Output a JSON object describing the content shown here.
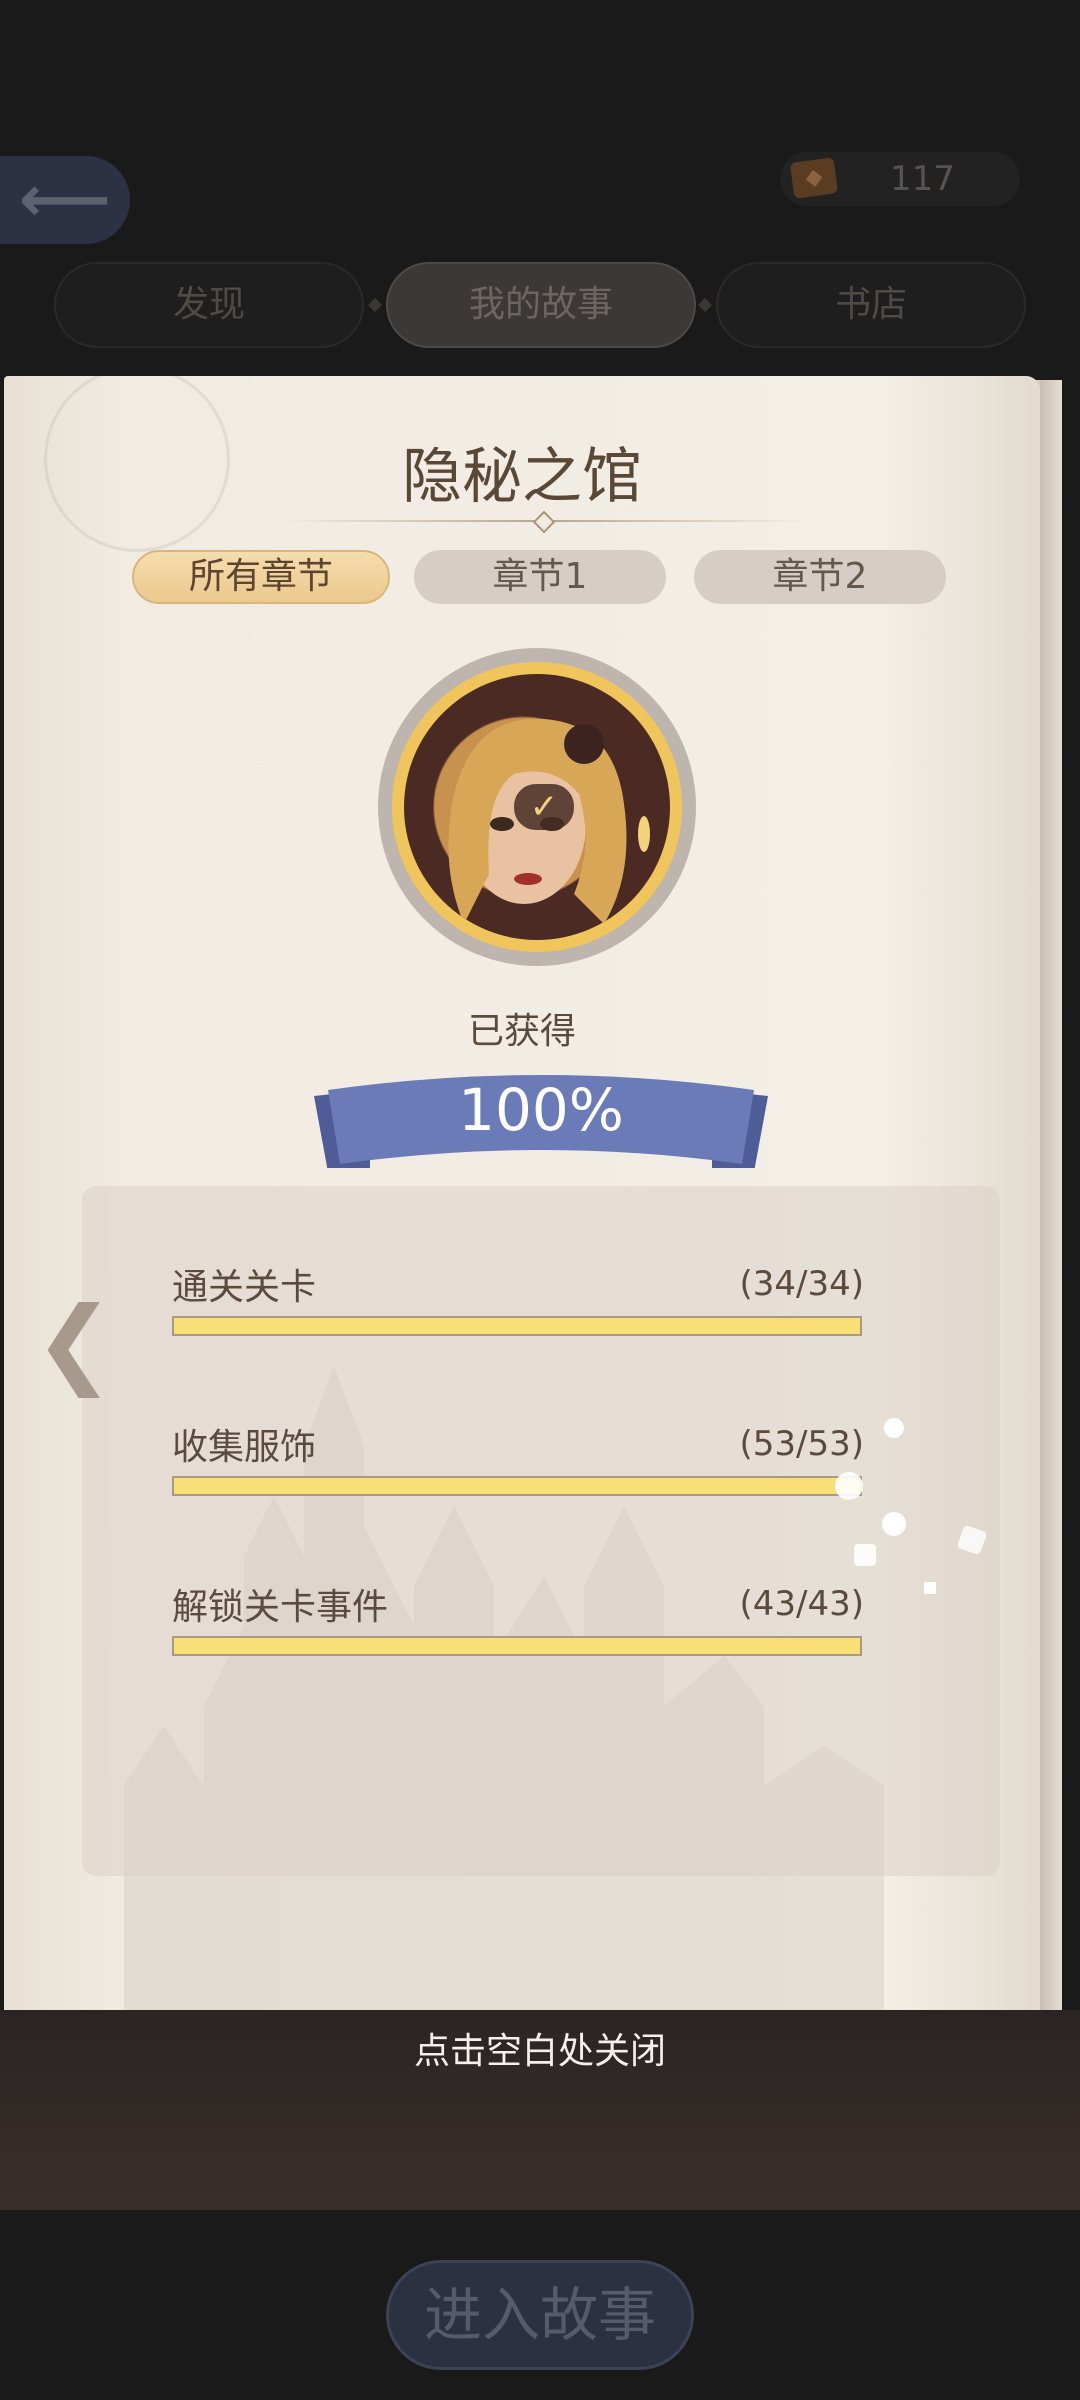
{
  "header": {
    "back_icon": "back-arrow-icon",
    "currency_icon": "ticket-icon",
    "currency_value": "117"
  },
  "tabs": [
    {
      "label": "发现",
      "active": false
    },
    {
      "label": "我的故事",
      "active": true
    },
    {
      "label": "书店",
      "active": false
    }
  ],
  "book": {
    "title": "隐秘之馆",
    "chapter_tabs": [
      {
        "label": "所有章节",
        "active": true
      },
      {
        "label": "章节1",
        "active": false
      },
      {
        "label": "章节2",
        "active": false
      }
    ],
    "avatar_status_icon": "check-icon",
    "obtained_label": "已获得",
    "progress_percent": "100%",
    "stats": [
      {
        "label": "通关关卡",
        "count": "(34/34)",
        "fraction": 1.0
      },
      {
        "label": "收集服饰",
        "count": "(53/53)",
        "fraction": 1.0
      },
      {
        "label": "解锁关卡事件",
        "count": "(43/43)",
        "fraction": 1.0
      }
    ],
    "prev_icon": "chevron-left-icon"
  },
  "footer": {
    "close_hint": "点击空白处关闭",
    "enter_button": "进入故事"
  },
  "colors": {
    "page": "#f1ebe2",
    "accent_gold": "#f0c65c",
    "ribbon_blue": "#6a7bb8",
    "bar_fill": "#f8df78",
    "text_brown": "#5a4836"
  }
}
